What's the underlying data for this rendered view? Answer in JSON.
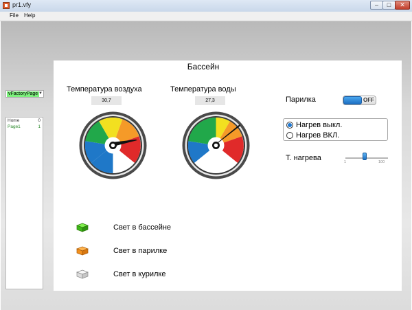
{
  "window": {
    "title": "pr1.vfy",
    "min": "–",
    "max": "□",
    "close": "✕"
  },
  "menu": [
    {
      "label": "File"
    },
    {
      "label": "Help"
    }
  ],
  "sidebar": {
    "page_select": "vFactoryPage",
    "pages": [
      {
        "name": "Home",
        "count": "0"
      },
      {
        "name": "Page1",
        "count": "1"
      }
    ]
  },
  "panel": {
    "title": "Бассейн",
    "gauges": [
      {
        "label": "Температура воздуха",
        "value": "30,7"
      },
      {
        "label": "Температура воды",
        "value": "27,3"
      }
    ],
    "sauna": {
      "label": "Парилка",
      "toggle_text": "OFF"
    },
    "heating": [
      {
        "label": "Нагрев выкл.",
        "selected": true
      },
      {
        "label": "Нагрев ВКЛ.",
        "selected": false
      }
    ],
    "heat_temp": {
      "label": "Т. нагрева",
      "min": "1",
      "max": "100",
      "value": 45
    },
    "lights": [
      {
        "label": "Свет в бассейне",
        "color": "#4fcf1f"
      },
      {
        "label": "Свет в парилке",
        "color": "#f5931e"
      },
      {
        "label": "Свет в курилке",
        "color": "#e6e6e6"
      }
    ]
  },
  "colors": {
    "gauge_blue": "#1f78c8",
    "gauge_green": "#21a84a",
    "gauge_yellow": "#f2e020",
    "gauge_orange": "#f59a28",
    "gauge_red": "#e02a2a",
    "accent": "#1f78d1"
  }
}
